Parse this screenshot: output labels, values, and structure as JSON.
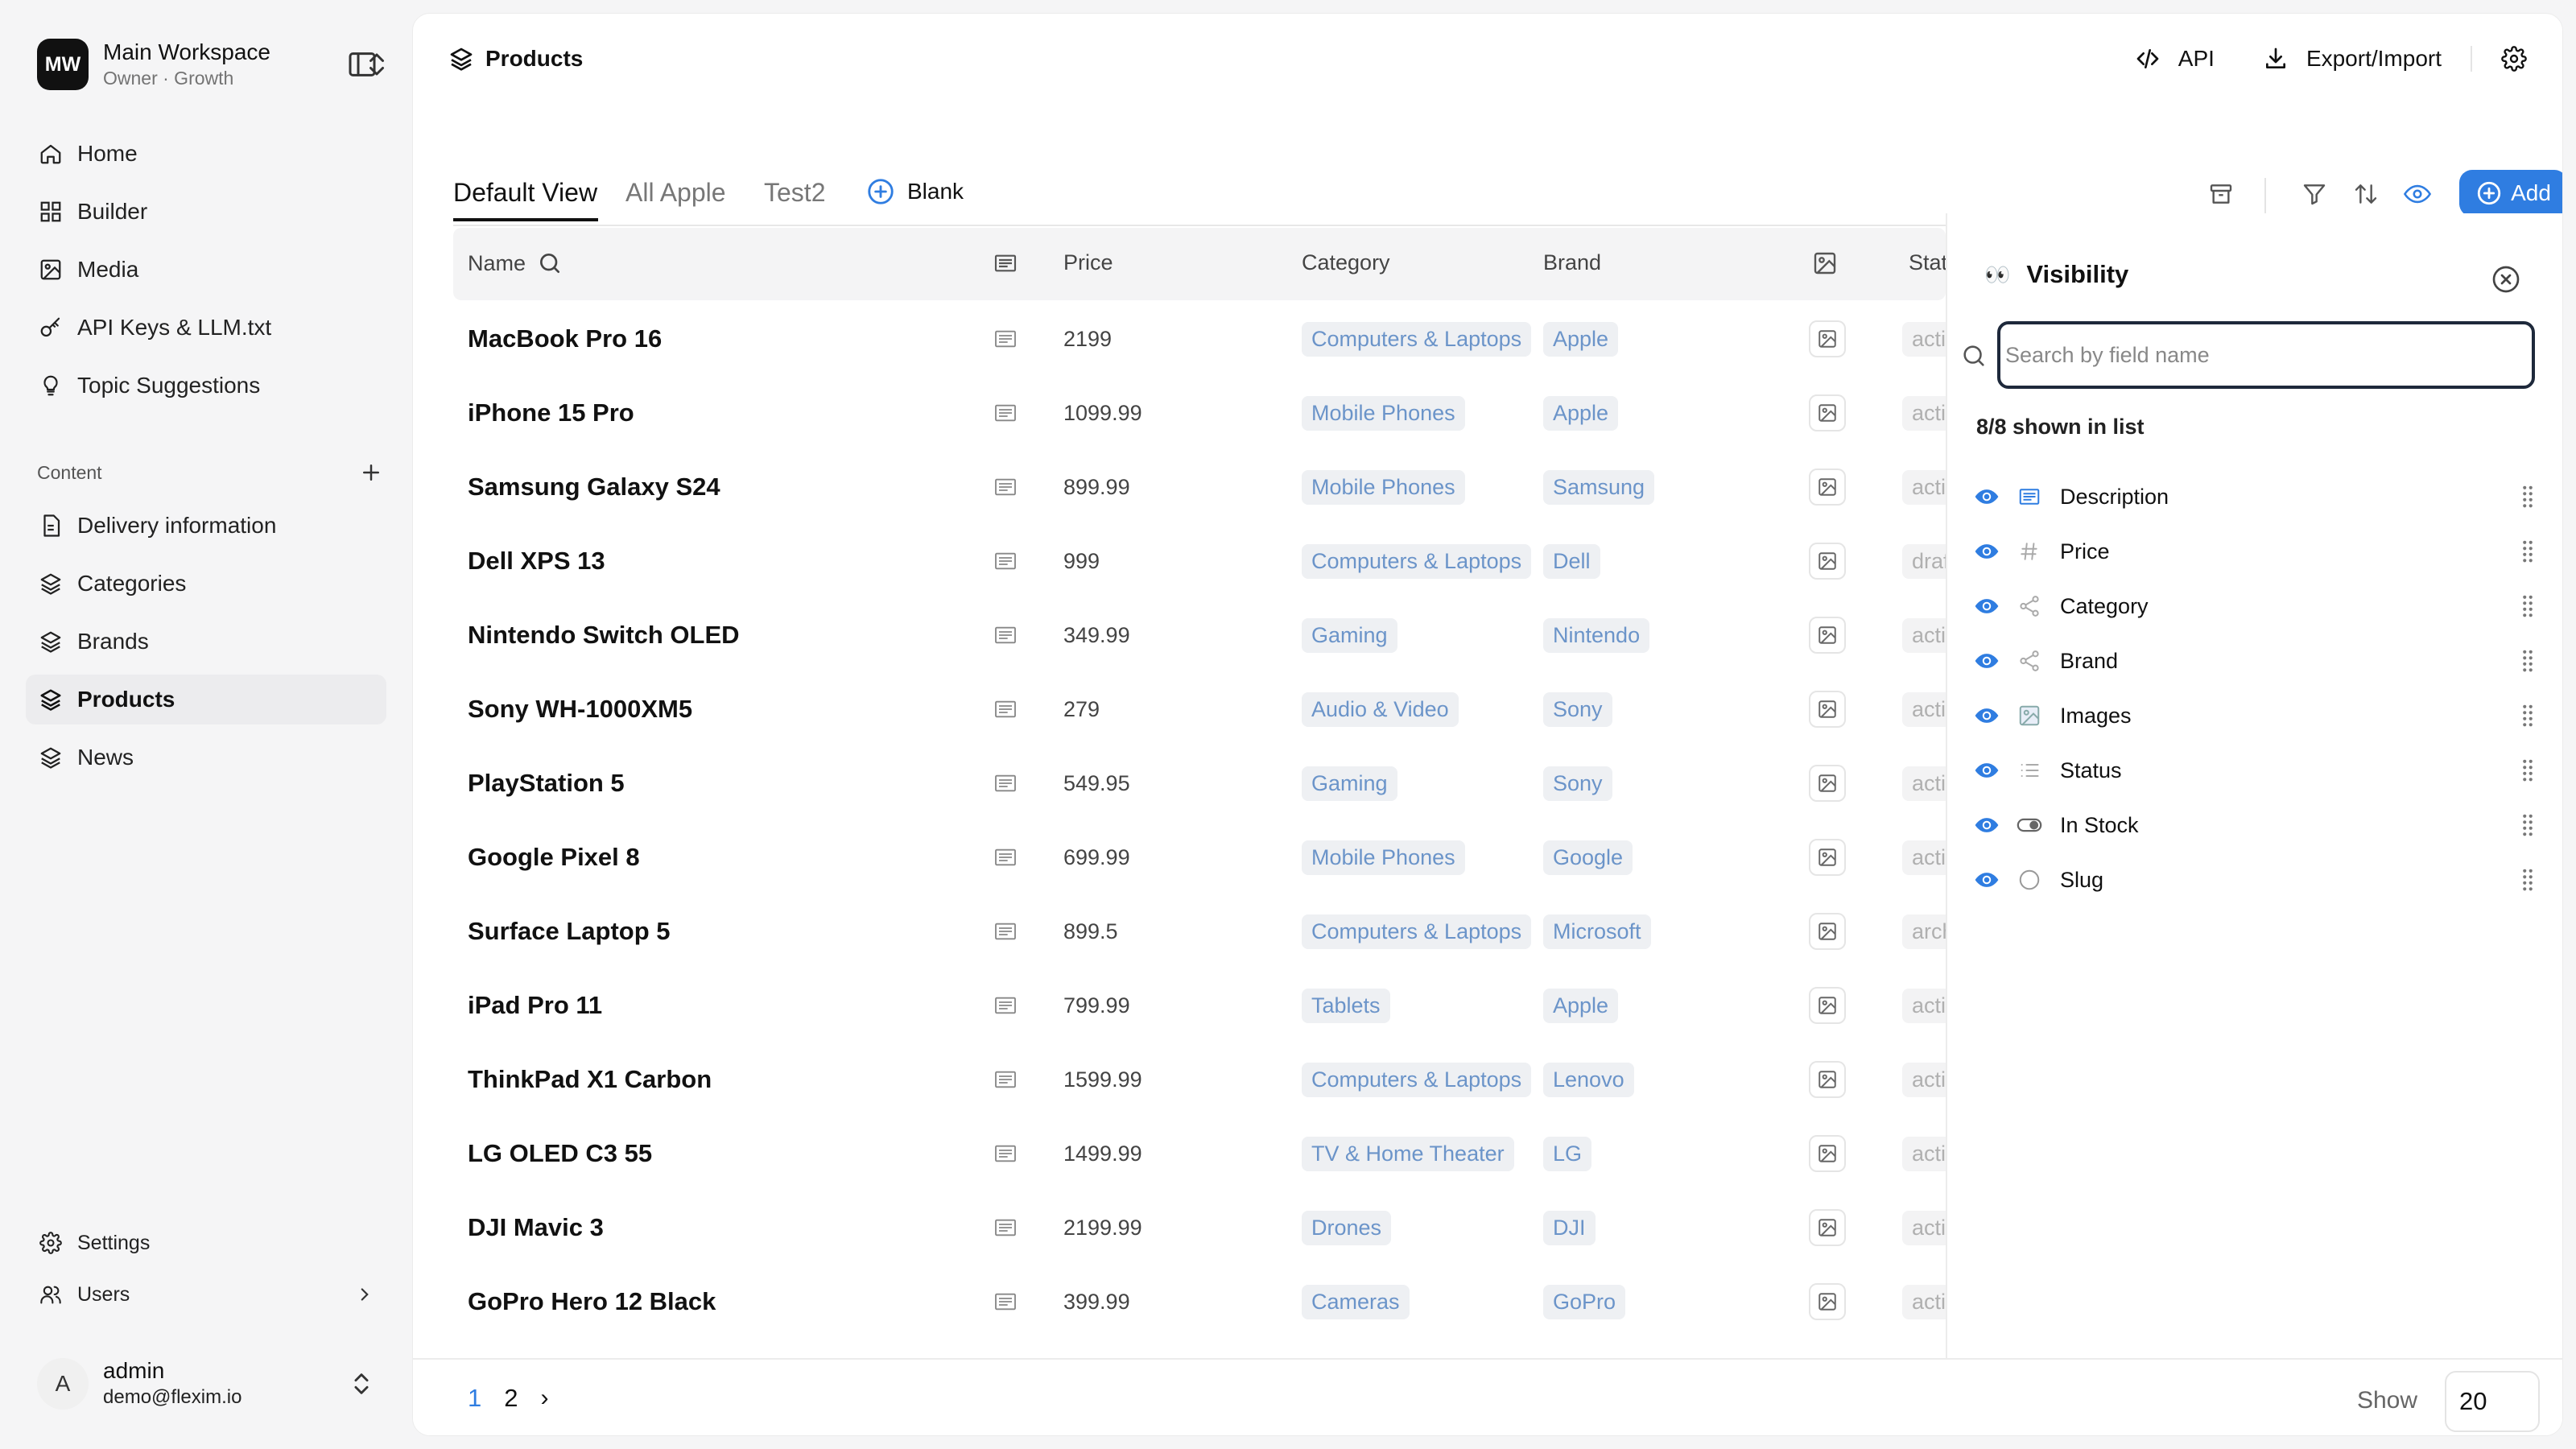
{
  "workspace": {
    "initials": "MW",
    "name": "Main Workspace",
    "subtitle": "Owner · Growth"
  },
  "nav": [
    {
      "label": "Home",
      "icon": "home-icon"
    },
    {
      "label": "Builder",
      "icon": "grid-icon"
    },
    {
      "label": "Media",
      "icon": "image-icon"
    },
    {
      "label": "API Keys & LLM.txt",
      "icon": "key-icon"
    },
    {
      "label": "Topic Suggestions",
      "icon": "lightbulb-icon"
    }
  ],
  "content_section": {
    "title": "Content",
    "items": [
      {
        "label": "Delivery information",
        "icon": "document-icon"
      },
      {
        "label": "Categories",
        "icon": "layers-icon"
      },
      {
        "label": "Brands",
        "icon": "layers-icon"
      },
      {
        "label": "Products",
        "icon": "layers-icon",
        "active": true
      },
      {
        "label": "News",
        "icon": "layers-icon"
      }
    ]
  },
  "bottom_nav": {
    "settings": "Settings",
    "users": "Users"
  },
  "user": {
    "initial": "A",
    "name": "admin",
    "email": "demo@flexim.io"
  },
  "header": {
    "title": "Products",
    "api_label": "API",
    "export_label": "Export/Import"
  },
  "tabs": [
    {
      "label": "Default View",
      "active": true
    },
    {
      "label": "All Apple"
    },
    {
      "label": "Test2"
    }
  ],
  "blank_label": "Blank",
  "add_label": "Add",
  "table": {
    "columns": {
      "name": "Name",
      "price": "Price",
      "category": "Category",
      "brand": "Brand",
      "status": "Status"
    },
    "rows": [
      {
        "name": "MacBook Pro 16",
        "price": "2199",
        "category": "Computers & Laptops",
        "brand": "Apple",
        "status": "active"
      },
      {
        "name": "iPhone 15 Pro",
        "price": "1099.99",
        "category": "Mobile Phones",
        "brand": "Apple",
        "status": "active"
      },
      {
        "name": "Samsung Galaxy S24",
        "price": "899.99",
        "category": "Mobile Phones",
        "brand": "Samsung",
        "status": "active"
      },
      {
        "name": "Dell XPS 13",
        "price": "999",
        "category": "Computers & Laptops",
        "brand": "Dell",
        "status": "draft"
      },
      {
        "name": "Nintendo Switch OLED",
        "price": "349.99",
        "category": "Gaming",
        "brand": "Nintendo",
        "status": "active"
      },
      {
        "name": "Sony WH-1000XM5",
        "price": "279",
        "category": "Audio & Video",
        "brand": "Sony",
        "status": "active"
      },
      {
        "name": "PlayStation 5",
        "price": "549.95",
        "category": "Gaming",
        "brand": "Sony",
        "status": "active"
      },
      {
        "name": "Google Pixel 8",
        "price": "699.99",
        "category": "Mobile Phones",
        "brand": "Google",
        "status": "active"
      },
      {
        "name": "Surface Laptop 5",
        "price": "899.5",
        "category": "Computers & Laptops",
        "brand": "Microsoft",
        "status": "archived"
      },
      {
        "name": "iPad Pro 11",
        "price": "799.99",
        "category": "Tablets",
        "brand": "Apple",
        "status": "active"
      },
      {
        "name": "ThinkPad X1 Carbon",
        "price": "1599.99",
        "category": "Computers & Laptops",
        "brand": "Lenovo",
        "status": "active"
      },
      {
        "name": "LG OLED C3 55",
        "price": "1499.99",
        "category": "TV & Home Theater",
        "brand": "LG",
        "status": "active"
      },
      {
        "name": "DJI Mavic 3",
        "price": "2199.99",
        "category": "Drones",
        "brand": "DJI",
        "status": "active"
      },
      {
        "name": "GoPro Hero 12 Black",
        "price": "399.99",
        "category": "Cameras",
        "brand": "GoPro",
        "status": "active"
      }
    ]
  },
  "visibility": {
    "title": "Visibility",
    "emoji": "👀",
    "search_placeholder": "Search by field name",
    "count_text": "8/8 shown in list",
    "fields": [
      {
        "label": "Description",
        "icon": "text-icon"
      },
      {
        "label": "Price",
        "icon": "hash-icon"
      },
      {
        "label": "Category",
        "icon": "relation-icon"
      },
      {
        "label": "Brand",
        "icon": "relation-icon"
      },
      {
        "label": "Images",
        "icon": "image-icon"
      },
      {
        "label": "Status",
        "icon": "list-icon"
      },
      {
        "label": "In Stock",
        "icon": "toggle-icon"
      },
      {
        "label": "Slug",
        "icon": "circle-icon"
      }
    ]
  },
  "pagination": {
    "pages": [
      "1",
      "2"
    ],
    "current": "1",
    "next": "›",
    "show_label": "Show",
    "page_size": "20"
  },
  "colors": {
    "accent": "#2f7de1",
    "pill_text": "#6b94c9",
    "pill_bg": "#eef0f3"
  }
}
